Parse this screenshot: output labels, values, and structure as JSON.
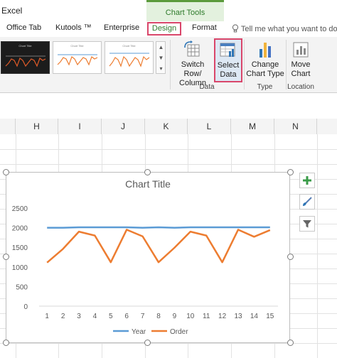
{
  "app": {
    "name": "Excel"
  },
  "context_tab_group": {
    "label": "Chart Tools",
    "color": "#2d7a2a"
  },
  "tabs": [
    {
      "label": "Office Tab"
    },
    {
      "label": "Kutools ™"
    },
    {
      "label": "Enterprise"
    },
    {
      "label": "Design",
      "active": true
    },
    {
      "label": "Format"
    }
  ],
  "tell_me": {
    "placeholder": "Tell me what you want to do..."
  },
  "ribbon": {
    "buttons": {
      "switch_row_column": {
        "line1": "Switch Row/",
        "line2": "Column"
      },
      "select_data": {
        "line1": "Select",
        "line2": "Data"
      },
      "change_chart_type": {
        "line1": "Change",
        "line2": "Chart Type"
      },
      "move_chart": {
        "line1": "Move",
        "line2": "Chart"
      }
    },
    "groups": {
      "data": "Data",
      "type": "Type",
      "location": "Location"
    }
  },
  "columns": [
    "H",
    "I",
    "J",
    "K",
    "L",
    "M",
    "N"
  ],
  "highlight_color": "#d9466a",
  "chart": {
    "title": "Chart Title",
    "side_buttons": [
      "plus-icon",
      "brush-icon",
      "filter-icon"
    ]
  },
  "chart_data": {
    "type": "line",
    "title": "Chart Title",
    "x": [
      1,
      2,
      3,
      4,
      5,
      6,
      7,
      8,
      9,
      10,
      11,
      12,
      13,
      14,
      15
    ],
    "ylim": [
      0,
      2500
    ],
    "yticks": [
      0,
      500,
      1000,
      1500,
      2000,
      2500
    ],
    "grid": false,
    "legend": "bottom",
    "series": [
      {
        "name": "Year",
        "color": "#5b9bd5",
        "values": [
          2000,
          2000,
          2010,
          2010,
          2010,
          2010,
          2000,
          2010,
          2000,
          2010,
          2010,
          2010,
          2010,
          2010,
          2010
        ]
      },
      {
        "name": "Order",
        "color": "#ed7d31",
        "values": [
          1110,
          1460,
          1900,
          1800,
          1120,
          1950,
          1780,
          1120,
          1490,
          1900,
          1800,
          1120,
          1950,
          1770,
          1940
        ]
      }
    ]
  }
}
